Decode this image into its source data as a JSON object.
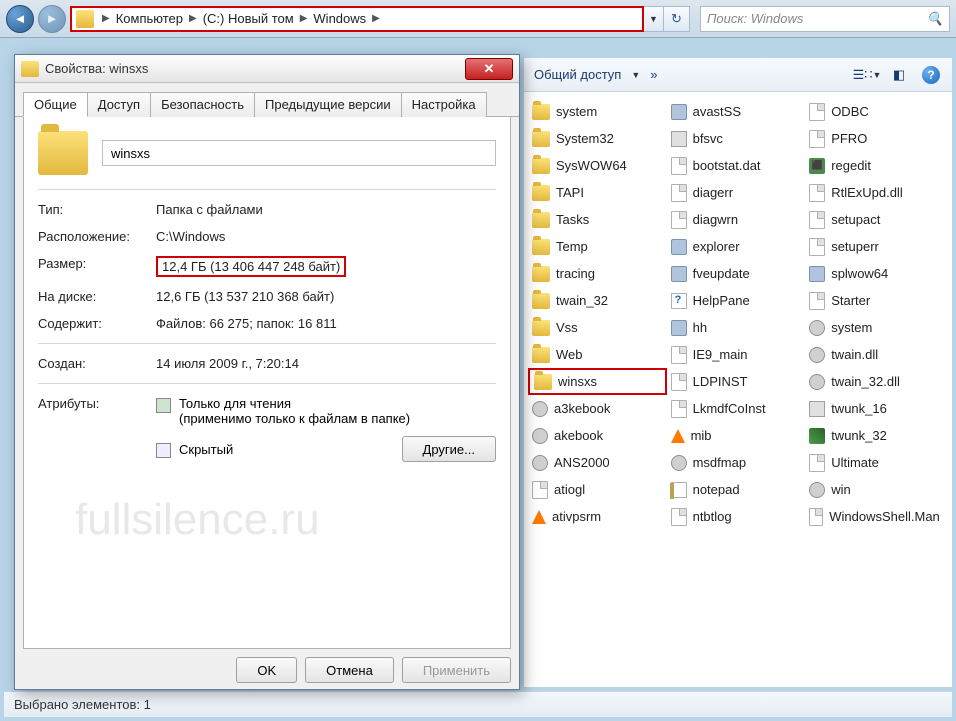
{
  "nav": {
    "crumbs": [
      "Компьютер",
      "(C:) Новый том",
      "Windows"
    ],
    "search_placeholder": "Поиск: Windows"
  },
  "toolbar": {
    "share_label": "Общий доступ",
    "more": "»"
  },
  "dialog": {
    "title": "Свойства: winsxs",
    "tabs": [
      "Общие",
      "Доступ",
      "Безопасность",
      "Предыдущие версии",
      "Настройка"
    ],
    "folder_name": "winsxs",
    "type_label": "Тип:",
    "type_value": "Папка с файлами",
    "location_label": "Расположение:",
    "location_value": "C:\\Windows",
    "size_label": "Размер:",
    "size_value": "12,4 ГБ (13 406 447 248 байт)",
    "ondisk_label": "На диске:",
    "ondisk_value": "12,6 ГБ (13 537 210 368 байт)",
    "contains_label": "Содержит:",
    "contains_value": "Файлов: 66 275; папок: 16 811",
    "created_label": "Создан:",
    "created_value": "14 июля 2009 г., 7:20:14",
    "attr_label": "Атрибуты:",
    "readonly_label": "Только для чтения",
    "readonly_note": "(применимо только к файлам в папке)",
    "hidden_label": "Скрытый",
    "other_btn": "Другие...",
    "ok_btn": "OK",
    "cancel_btn": "Отмена",
    "apply_btn": "Применить"
  },
  "files": {
    "col1": [
      {
        "icon": "folder",
        "name": "system"
      },
      {
        "icon": "folder",
        "name": "System32"
      },
      {
        "icon": "folder",
        "name": "SysWOW64"
      },
      {
        "icon": "folder",
        "name": "TAPI"
      },
      {
        "icon": "folder",
        "name": "Tasks"
      },
      {
        "icon": "folder",
        "name": "Temp"
      },
      {
        "icon": "folder",
        "name": "tracing"
      },
      {
        "icon": "folder",
        "name": "twain_32"
      },
      {
        "icon": "folder",
        "name": "Vss"
      },
      {
        "icon": "folder",
        "name": "Web"
      },
      {
        "icon": "folder",
        "name": "winsxs",
        "sel": true
      },
      {
        "icon": "gear",
        "name": "a3kebook"
      },
      {
        "icon": "gear",
        "name": "akebook"
      },
      {
        "icon": "gear",
        "name": "ANS2000"
      },
      {
        "icon": "file",
        "name": "atiogl"
      },
      {
        "icon": "vlc",
        "name": "ativpsrm"
      }
    ],
    "col2": [
      {
        "icon": "exe",
        "name": "avastSS"
      },
      {
        "icon": "bin",
        "name": "bfsvc"
      },
      {
        "icon": "file",
        "name": "bootstat.dat"
      },
      {
        "icon": "file",
        "name": "diagerr"
      },
      {
        "icon": "file",
        "name": "diagwrn"
      },
      {
        "icon": "exe",
        "name": "explorer"
      },
      {
        "icon": "exe",
        "name": "fveupdate"
      },
      {
        "icon": "chm",
        "name": "HelpPane"
      },
      {
        "icon": "exe",
        "name": "hh"
      },
      {
        "icon": "file",
        "name": "IE9_main"
      },
      {
        "icon": "file",
        "name": "LDPINST"
      },
      {
        "icon": "file",
        "name": "LkmdfCoInst"
      },
      {
        "icon": "vlc",
        "name": "mib"
      },
      {
        "icon": "gear",
        "name": "msdfmap"
      },
      {
        "icon": "notepad",
        "name": "notepad"
      },
      {
        "icon": "file",
        "name": "ntbtlog"
      }
    ],
    "col3": [
      {
        "icon": "file",
        "name": "ODBC"
      },
      {
        "icon": "file",
        "name": "PFRO"
      },
      {
        "icon": "reg",
        "name": "regedit"
      },
      {
        "icon": "file",
        "name": "RtlExUpd.dll"
      },
      {
        "icon": "file",
        "name": "setupact"
      },
      {
        "icon": "file",
        "name": "setuperr"
      },
      {
        "icon": "exe",
        "name": "splwow64"
      },
      {
        "icon": "file",
        "name": "Starter"
      },
      {
        "icon": "gear",
        "name": "system"
      },
      {
        "icon": "gear",
        "name": "twain.dll"
      },
      {
        "icon": "gear",
        "name": "twain_32.dll"
      },
      {
        "icon": "bin",
        "name": "twunk_16"
      },
      {
        "icon": "img",
        "name": "twunk_32"
      },
      {
        "icon": "file",
        "name": "Ultimate"
      },
      {
        "icon": "gear",
        "name": "win"
      },
      {
        "icon": "file",
        "name": "WindowsShell.Man"
      }
    ]
  },
  "status": {
    "text": "Выбрано элементов: 1"
  },
  "watermark": "fullsilence.ru"
}
